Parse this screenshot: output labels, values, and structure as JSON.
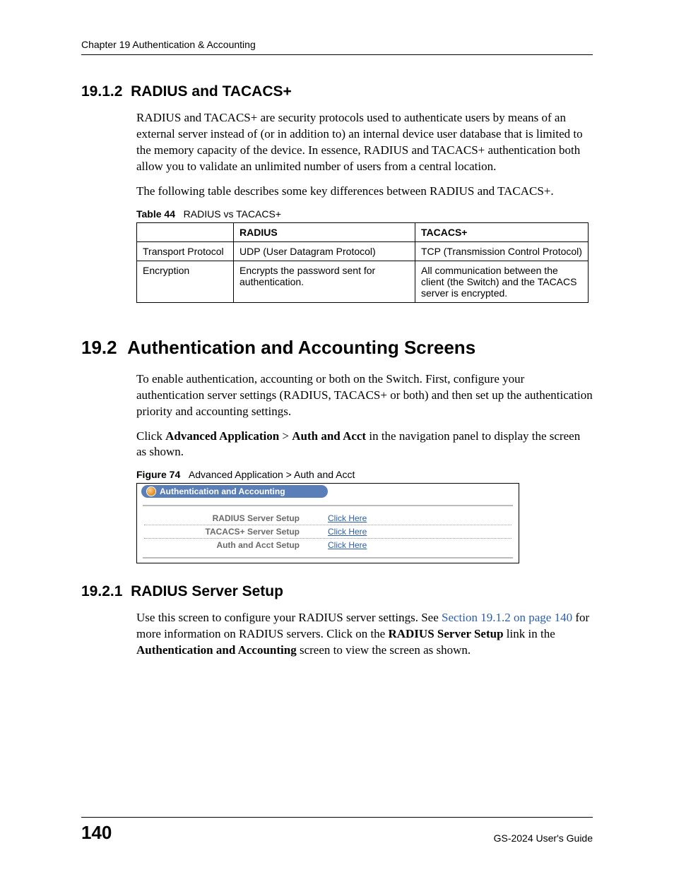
{
  "header": {
    "running": "Chapter 19 Authentication & Accounting"
  },
  "s1912": {
    "num": "19.1.2",
    "title": "RADIUS and TACACS+",
    "p1": "RADIUS and TACACS+ are security protocols used to authenticate users by means of an external server instead of (or in addition to) an internal device user database that is limited to the memory capacity of the device. In essence, RADIUS and TACACS+ authentication both allow you to validate an unlimited number of users from a central location.",
    "p2": "The following table describes some key differences between RADIUS and TACACS+."
  },
  "table44": {
    "caption_label": "Table 44",
    "caption_text": "RADIUS vs TACACS+",
    "cols": [
      "",
      "RADIUS",
      "TACACS+"
    ],
    "rows": [
      {
        "c0": "Transport Protocol",
        "c1": "UDP (User Datagram Protocol)",
        "c2": "TCP (Transmission Control Protocol)"
      },
      {
        "c0": "Encryption",
        "c1": "Encrypts the password sent for authentication.",
        "c2": "All communication between the client (the Switch) and the TACACS server is encrypted."
      }
    ]
  },
  "s192": {
    "num": "19.2",
    "title": "Authentication and Accounting Screens",
    "p1": "To enable authentication, accounting or both on the Switch. First, configure your authentication server settings (RADIUS, TACACS+ or both) and then set up the authentication priority and accounting settings.",
    "p2a": "Click ",
    "p2b": "Advanced Application",
    "p2c": " > ",
    "p2d": "Auth and Acct",
    "p2e": " in the navigation panel to display the screen as shown."
  },
  "figure74": {
    "caption_label": "Figure 74",
    "caption_text": "Advanced Application > Auth and Acct",
    "panel_title": "Authentication and Accounting",
    "rows": [
      {
        "label": "RADIUS Server Setup",
        "link": "Click Here"
      },
      {
        "label": "TACACS+ Server Setup",
        "link": "Click Here"
      },
      {
        "label": "Auth and Acct Setup",
        "link": "Click Here"
      }
    ]
  },
  "s1921": {
    "num": "19.2.1",
    "title": "RADIUS Server Setup",
    "p1a": "Use this screen to configure your RADIUS server settings. See ",
    "p1link": "Section 19.1.2 on page 140",
    "p1b": " for more information on RADIUS servers. Click on the ",
    "p1bold1": "RADIUS Server Setup",
    "p1c": " link in the ",
    "p1bold2": "Authentication and Accounting",
    "p1d": " screen to view the screen as shown."
  },
  "footer": {
    "page": "140",
    "guide": "GS-2024 User's Guide"
  }
}
